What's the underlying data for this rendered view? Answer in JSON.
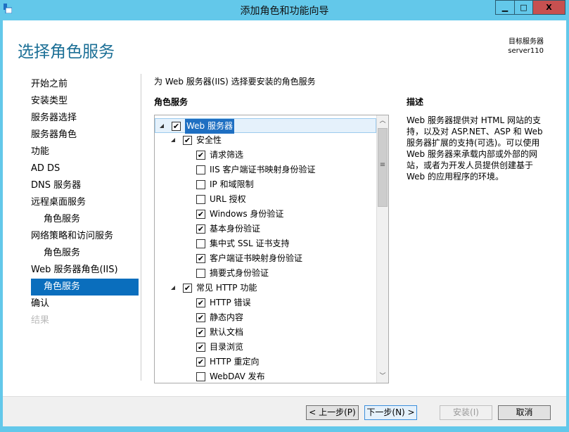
{
  "window": {
    "title": "添加角色和功能向导",
    "minimize": "▁",
    "maximize": "□",
    "close": "X"
  },
  "header": {
    "page_title": "选择角色服务",
    "target_label": "目标服务器",
    "target_value": "server110"
  },
  "nav": [
    {
      "label": "开始之前",
      "level": 0,
      "state": "normal"
    },
    {
      "label": "安装类型",
      "level": 0,
      "state": "normal"
    },
    {
      "label": "服务器选择",
      "level": 0,
      "state": "normal"
    },
    {
      "label": "服务器角色",
      "level": 0,
      "state": "normal"
    },
    {
      "label": "功能",
      "level": 0,
      "state": "normal"
    },
    {
      "label": "AD DS",
      "level": 0,
      "state": "normal"
    },
    {
      "label": "DNS 服务器",
      "level": 0,
      "state": "normal"
    },
    {
      "label": "远程桌面服务",
      "level": 0,
      "state": "normal"
    },
    {
      "label": "角色服务",
      "level": 1,
      "state": "normal"
    },
    {
      "label": "网络策略和访问服务",
      "level": 0,
      "state": "normal"
    },
    {
      "label": "角色服务",
      "level": 1,
      "state": "normal"
    },
    {
      "label": "Web 服务器角色(IIS)",
      "level": 0,
      "state": "normal"
    },
    {
      "label": "角色服务",
      "level": 1,
      "state": "active"
    },
    {
      "label": "确认",
      "level": 0,
      "state": "normal"
    },
    {
      "label": "结果",
      "level": 0,
      "state": "disabled"
    }
  ],
  "main": {
    "instruction": "为 Web 服务器(IIS) 选择要安装的角色服务",
    "roles_label": "角色服务",
    "tree": [
      {
        "label": "Web 服务器",
        "level": 0,
        "checked": true,
        "expander": true,
        "selected": true
      },
      {
        "label": "安全性",
        "level": 1,
        "checked": true,
        "expander": true
      },
      {
        "label": "请求筛选",
        "level": 2,
        "checked": true
      },
      {
        "label": "IIS 客户端证书映射身份验证",
        "level": 2,
        "checked": false
      },
      {
        "label": "IP 和域限制",
        "level": 2,
        "checked": false
      },
      {
        "label": "URL 授权",
        "level": 2,
        "checked": false
      },
      {
        "label": "Windows 身份验证",
        "level": 2,
        "checked": true
      },
      {
        "label": "基本身份验证",
        "level": 2,
        "checked": true
      },
      {
        "label": "集中式 SSL 证书支持",
        "level": 2,
        "checked": false
      },
      {
        "label": "客户端证书映射身份验证",
        "level": 2,
        "checked": true
      },
      {
        "label": "摘要式身份验证",
        "level": 2,
        "checked": false
      },
      {
        "label": "常见 HTTP 功能",
        "level": 1,
        "checked": true,
        "expander": true
      },
      {
        "label": "HTTP 错误",
        "level": 2,
        "checked": true
      },
      {
        "label": "静态内容",
        "level": 2,
        "checked": true
      },
      {
        "label": "默认文档",
        "level": 2,
        "checked": true
      },
      {
        "label": "目录浏览",
        "level": 2,
        "checked": true
      },
      {
        "label": "HTTP 重定向",
        "level": 2,
        "checked": true
      },
      {
        "label": "WebDAV 发布",
        "level": 2,
        "checked": false
      }
    ],
    "description_label": "描述",
    "description": "Web 服务器提供对 HTML 网站的支持，以及对 ASP.NET、ASP 和 Web 服务器扩展的支持(可选)。可以使用 Web 服务器来承载内部或外部的网站，或者为开发人员提供创建基于 Web 的应用程序的环境。"
  },
  "footer": {
    "prev": "< 上一步(P)",
    "next": "下一步(N) >",
    "install": "安装(I)",
    "cancel": "取消"
  }
}
